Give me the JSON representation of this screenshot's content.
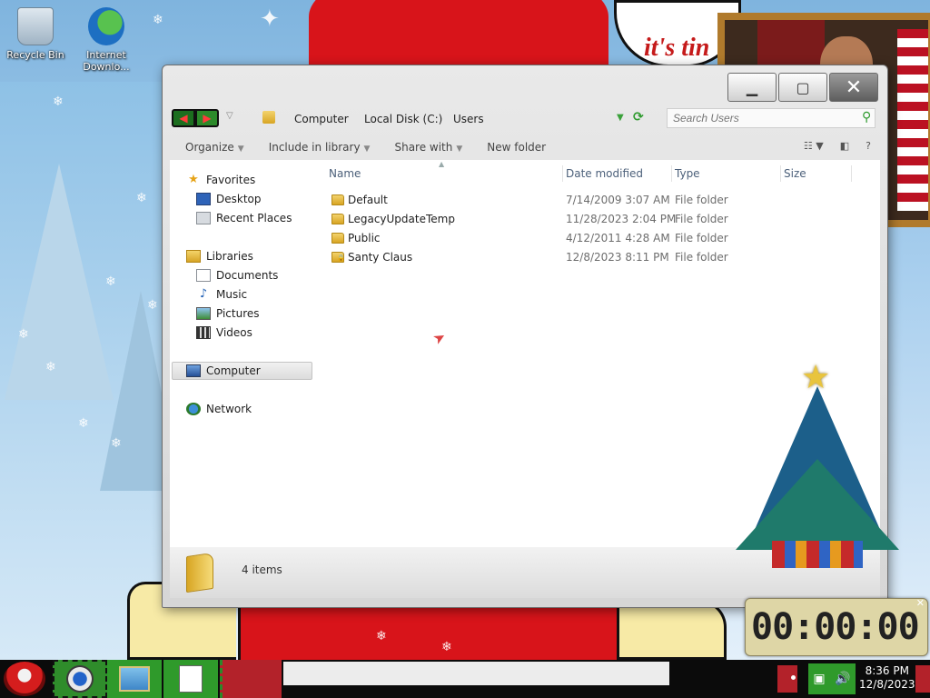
{
  "desktop": {
    "icons": [
      {
        "label": "Recycle Bin"
      },
      {
        "label": "Internet Downlo..."
      }
    ],
    "speech_text": "it's tin"
  },
  "window": {
    "address": {
      "crumbs": [
        "Computer",
        "Local Disk (C:)",
        "Users"
      ],
      "search_placeholder": "Search Users"
    },
    "commands": [
      "Organize",
      "Include in library",
      "Share with",
      "New folder"
    ],
    "nav_pane": {
      "favorites": "Favorites",
      "favorite_items": [
        "Desktop",
        "Recent Places"
      ],
      "libraries": "Libraries",
      "library_items": [
        "Documents",
        "Music",
        "Pictures",
        "Videos"
      ],
      "computer": "Computer",
      "network": "Network"
    },
    "columns": [
      "Name",
      "Date modified",
      "Type",
      "Size"
    ],
    "files": [
      {
        "name": "Default",
        "date": "7/14/2009 3:07 AM",
        "type": "File folder",
        "locked": false
      },
      {
        "name": "LegacyUpdateTemp",
        "date": "11/28/2023 2:04 PM",
        "type": "File folder",
        "locked": false
      },
      {
        "name": "Public",
        "date": "4/12/2011 4:28 AM",
        "type": "File folder",
        "locked": false
      },
      {
        "name": "Santy Claus",
        "date": "12/8/2023 8:11 PM",
        "type": "File folder",
        "locked": true
      }
    ],
    "details": {
      "item_count": "4 items"
    }
  },
  "timer": {
    "display": "00:00:00"
  },
  "taskbar": {
    "clock_time": "8:36 PM",
    "clock_date": "12/8/2023"
  },
  "colors": {
    "accent_green": "#2f9a2b",
    "accent_red": "#b3222a",
    "hat_red": "#d8141a"
  }
}
